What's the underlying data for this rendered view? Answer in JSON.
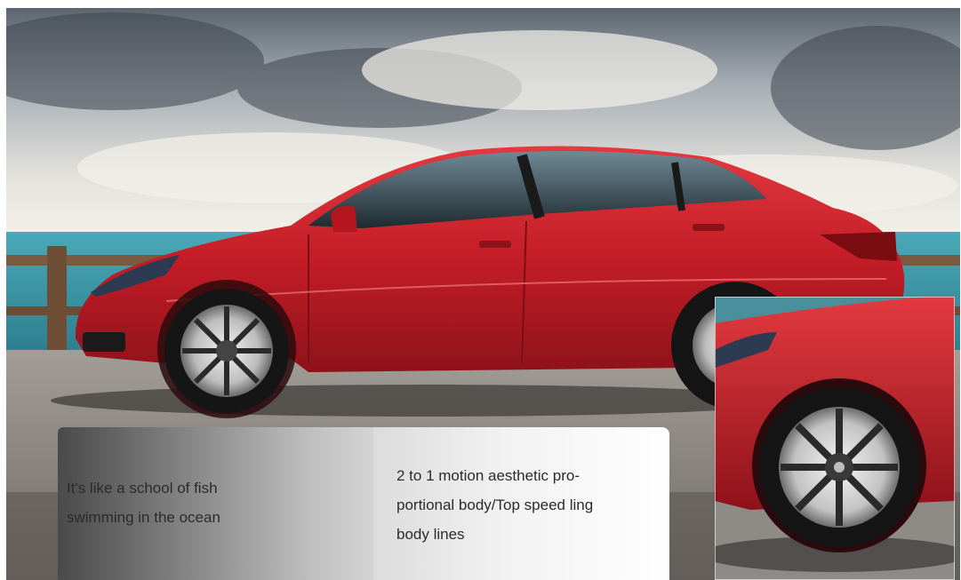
{
  "photo": {
    "subject": "red sedan",
    "setting": "seaside promenade"
  },
  "captions": {
    "left": {
      "line1": "It's like a school of fish",
      "line2": "swimming in the ocean"
    },
    "right": {
      "line1": "2 to 1 motion aesthetic pro-",
      "line2": "portional body/Top speed ling",
      "line3": "body lines"
    }
  },
  "colors": {
    "car_red": "#c8202a",
    "sky": "#d9dde2",
    "sea": "#3f9fb0",
    "ground": "#8a8580"
  }
}
